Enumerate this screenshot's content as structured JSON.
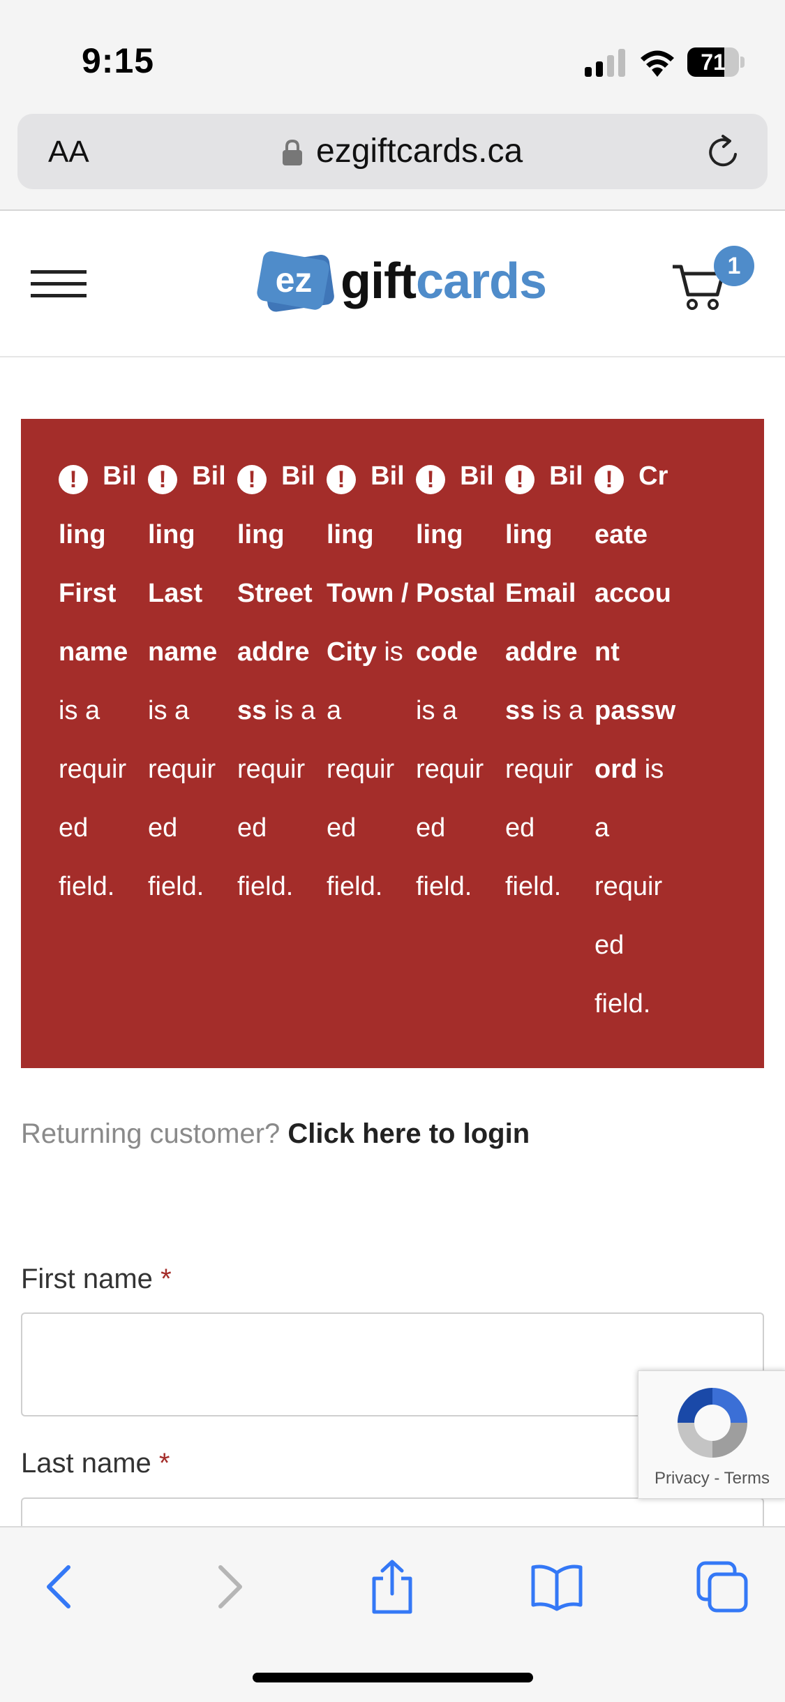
{
  "status_bar": {
    "time": "9:15",
    "battery": "71",
    "battery_level": 0.71
  },
  "browser": {
    "text_size_label": "AA",
    "url": "ezgiftcards.ca"
  },
  "site": {
    "logo": {
      "mark": "ez",
      "word_part1": "gift",
      "word_part2": "cards"
    },
    "cart_count": "1"
  },
  "errors": [
    {
      "parts": [
        "Bil",
        "ling",
        "First",
        "name"
      ],
      "rest": [
        "is a",
        "requir",
        "ed",
        "field."
      ]
    },
    {
      "parts": [
        "Bil",
        "ling",
        "Last",
        "name"
      ],
      "rest": [
        "is a",
        "requir",
        "ed",
        "field."
      ]
    },
    {
      "parts": [
        "Bil",
        "ling",
        "Street",
        "addre",
        "ss"
      ],
      "rest": [
        " is a",
        "requir",
        "ed",
        "field."
      ]
    },
    {
      "parts": [
        "Bil",
        "ling",
        "Town /",
        "City"
      ],
      "rest": [
        " is",
        "a",
        "requir",
        "ed",
        "field."
      ]
    },
    {
      "parts": [
        "Bil",
        "ling",
        "Postal",
        "code"
      ],
      "rest": [
        "is a",
        "requir",
        "ed",
        "field."
      ]
    },
    {
      "parts": [
        "Bil",
        "ling",
        "Email",
        "addre",
        "ss"
      ],
      "rest": [
        " is a",
        "requir",
        "ed",
        "field."
      ]
    },
    {
      "parts": [
        "Cr",
        "eate",
        "accou",
        "nt",
        "passw",
        "ord"
      ],
      "rest": [
        " is",
        "a",
        "requir",
        "ed",
        "field."
      ]
    }
  ],
  "returning": {
    "text": "Returning customer? ",
    "link": "Click here to login"
  },
  "form": {
    "first_name_label": "First name",
    "last_name_label": "Last name",
    "required_mark": "*",
    "first_name_value": "",
    "last_name_value": ""
  },
  "recaptcha": {
    "privacy": "Privacy",
    "separator": " - ",
    "terms": "Terms"
  },
  "colors": {
    "error_bg": "#a42d2a",
    "brand_blue": "#4f8cca"
  },
  "icons": [
    "signal-icon",
    "wifi-icon",
    "battery-icon",
    "lock-icon",
    "reload-icon",
    "menu-icon",
    "cart-icon",
    "back-icon",
    "forward-icon",
    "share-icon",
    "bookmarks-icon",
    "tabs-icon"
  ]
}
